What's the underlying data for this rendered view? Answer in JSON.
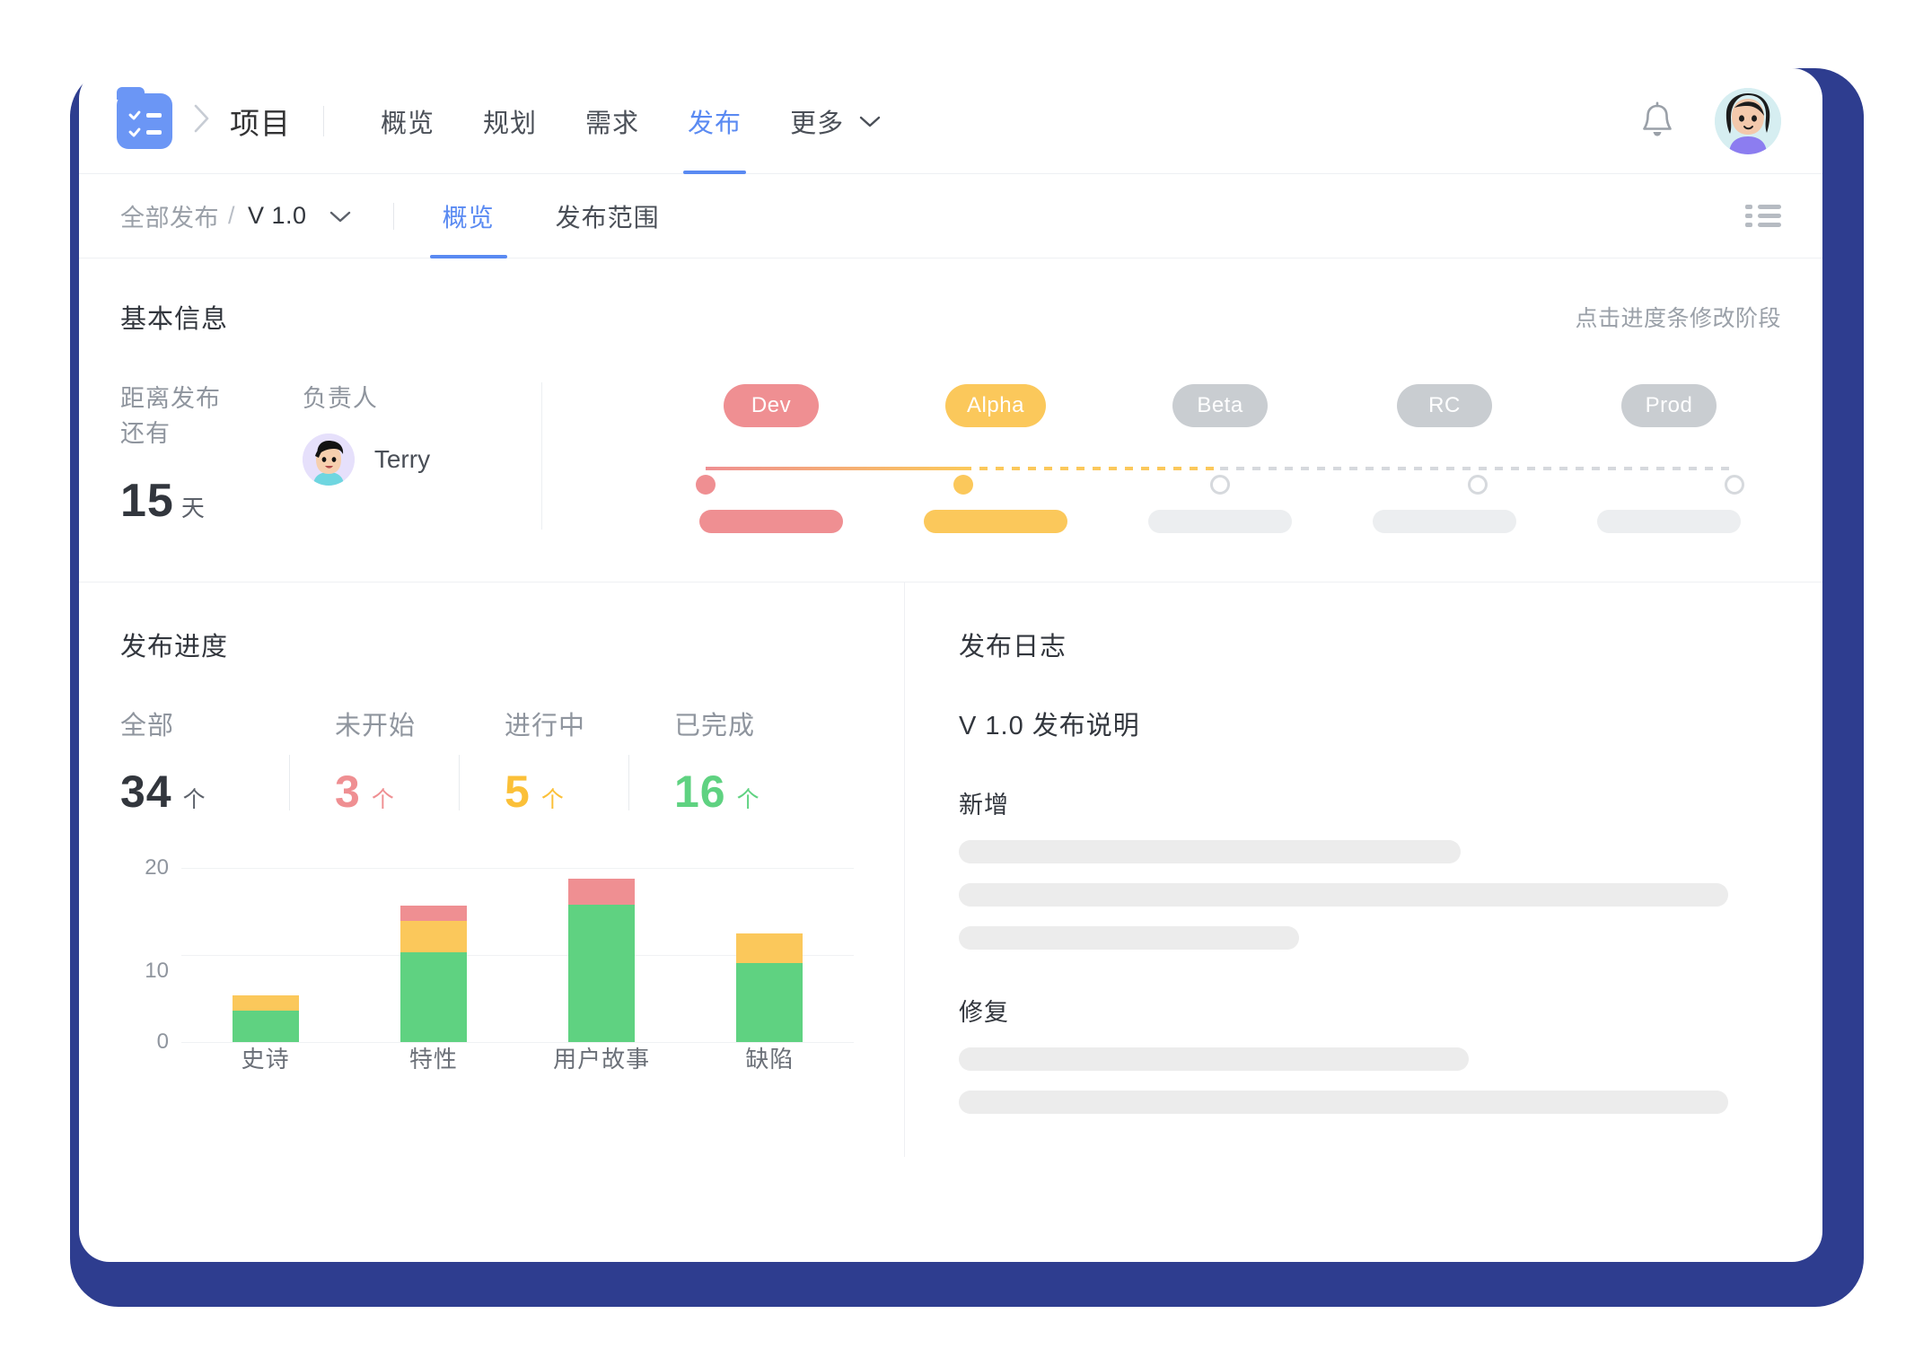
{
  "theme": {
    "frame_color": "#2e3d8f",
    "accent": "#5a8af2",
    "red": "#ef8f92",
    "yellow": "#fbc85b",
    "green": "#5fd281",
    "gray": "#c9cdd1"
  },
  "topbar": {
    "logo_icon": "checklist-folder-icon",
    "breadcrumb_separator_icon": "chevron-right-icon",
    "project_title": "项目",
    "nav": [
      {
        "label": "概览",
        "active": false
      },
      {
        "label": "规划",
        "active": false
      },
      {
        "label": "需求",
        "active": false
      },
      {
        "label": "发布",
        "active": true
      },
      {
        "label": "更多",
        "active": false,
        "caret": true
      }
    ],
    "bell_icon": "bell-icon",
    "avatar_icon": "user-avatar"
  },
  "subbar": {
    "breadcrumb_root": "全部发布",
    "breadcrumb_slash": "/",
    "breadcrumb_current": "V 1.0",
    "breadcrumb_caret_icon": "chevron-down-icon",
    "tabs": [
      {
        "label": "概览",
        "active": true
      },
      {
        "label": "发布范围",
        "active": false
      }
    ],
    "list_view_icon": "list-icon"
  },
  "basic_info": {
    "title": "基本信息",
    "hint": "点击进度条修改阶段",
    "days_label": "距离发布还有",
    "days_value": "15",
    "days_unit": "天",
    "owner_label": "负责人",
    "owner_name": "Terry",
    "stages": [
      {
        "name": "Dev",
        "state": "done",
        "chip_color": "#ef8f92",
        "bar_color": "#ef8f92"
      },
      {
        "name": "Alpha",
        "state": "current",
        "chip_color": "#fbc85b",
        "bar_color": "#fbc85b"
      },
      {
        "name": "Beta",
        "state": "upcoming",
        "chip_color": "#c9cdd1",
        "bar_color": "#eceef0"
      },
      {
        "name": "RC",
        "state": "upcoming",
        "chip_color": "#c9cdd1",
        "bar_color": "#eceef0"
      },
      {
        "name": "Prod",
        "state": "upcoming",
        "chip_color": "#c9cdd1",
        "bar_color": "#eceef0"
      }
    ]
  },
  "progress_panel": {
    "title": "发布进度",
    "stats": [
      {
        "label": "全部",
        "value": "34",
        "unit": "个",
        "color": "#32363d"
      },
      {
        "label": "未开始",
        "value": "3",
        "unit": "个",
        "color": "#ef8f92"
      },
      {
        "label": "进行中",
        "value": "5",
        "unit": "个",
        "color": "#fbc85b"
      },
      {
        "label": "已完成",
        "value": "16",
        "unit": "个",
        "color": "#5fd281"
      }
    ]
  },
  "chart_data": {
    "type": "bar",
    "stacked": true,
    "title": "",
    "xlabel": "",
    "ylabel": "",
    "ylim": [
      0,
      20
    ],
    "yticks": [
      0,
      10,
      20
    ],
    "grid": true,
    "legend": false,
    "categories": [
      "史诗",
      "特性",
      "用户故事",
      "缺陷"
    ],
    "series": [
      {
        "name": "已完成",
        "color": "#5fd281",
        "values": [
          3,
          8.5,
          13,
          7.5
        ]
      },
      {
        "name": "进行中",
        "color": "#fbc85b",
        "values": [
          1.5,
          3,
          0,
          2.8
        ]
      },
      {
        "name": "未开始",
        "color": "#ef8f92",
        "values": [
          0,
          1.5,
          2.5,
          0
        ]
      }
    ]
  },
  "log_panel": {
    "title": "发布日志",
    "version_title": "V 1.0 发布说明",
    "groups": [
      {
        "title": "新增",
        "lines": [
          {
            "width": "62%"
          },
          {
            "width": "95%"
          },
          {
            "width": "42%"
          }
        ]
      },
      {
        "title": "修复",
        "lines": [
          {
            "width": "63%"
          },
          {
            "width": "95%"
          }
        ]
      }
    ]
  }
}
